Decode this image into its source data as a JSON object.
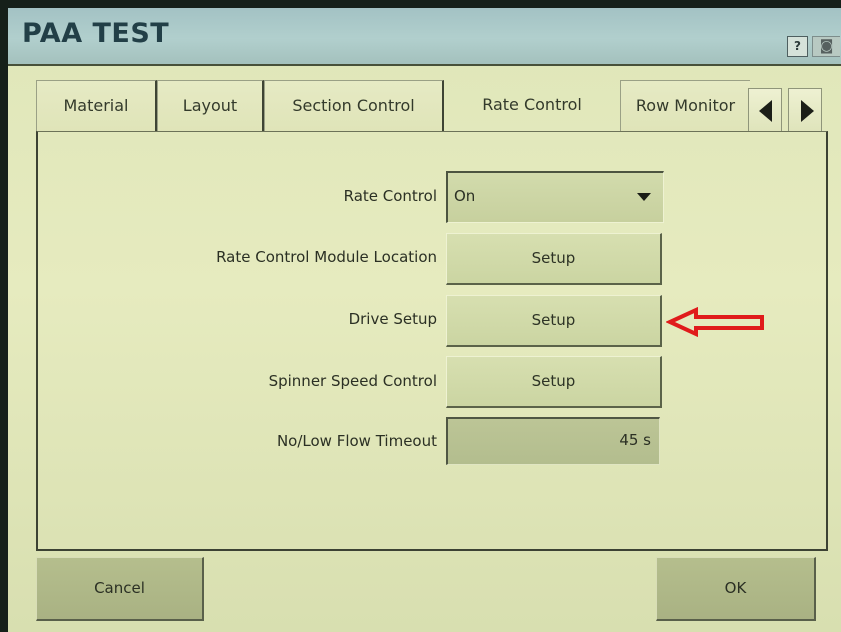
{
  "window": {
    "title": "PAA TEST",
    "help_icon": "?"
  },
  "tabs": [
    {
      "label": "Material",
      "active": false
    },
    {
      "label": "Layout",
      "active": false
    },
    {
      "label": "Section Control",
      "active": false
    },
    {
      "label": "Rate Control",
      "active": true
    },
    {
      "label": "Row Monitor",
      "active": false
    }
  ],
  "form": {
    "rate_control": {
      "label": "Rate Control",
      "value": "On"
    },
    "module_location": {
      "label": "Rate Control Module Location",
      "button": "Setup"
    },
    "drive_setup": {
      "label": "Drive Setup",
      "button": "Setup"
    },
    "spinner_speed": {
      "label": "Spinner Speed Control",
      "button": "Setup"
    },
    "flow_timeout": {
      "label": "No/Low Flow Timeout",
      "value": "45 s"
    }
  },
  "footer": {
    "cancel_label": "Cancel",
    "ok_label": "OK"
  },
  "colors": {
    "screen_bg": "#e3e9bc",
    "title_bar": "#acc9c7",
    "title_text": "#223f47",
    "annotation_arrow": "#e01b1b"
  },
  "icons": {
    "help": "help-icon",
    "camera": "camera-icon",
    "tab_scroll_left": "arrow-left-icon",
    "tab_scroll_right": "arrow-right-icon",
    "dropdown": "chevron-down-icon",
    "annotation": "red-outline-arrow-icon"
  }
}
